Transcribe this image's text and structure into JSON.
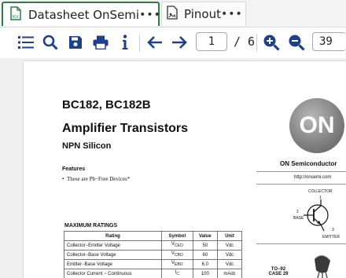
{
  "tabs": [
    {
      "label": "Datasheet OnSemi",
      "more": "•••"
    },
    {
      "label": "Pinout",
      "more": "•••"
    }
  ],
  "toolbar": {
    "page_current": "1",
    "page_total": "/ 6",
    "zoom": "39"
  },
  "document": {
    "part_number": "BC182, BC182B",
    "title": "Amplifier Transistors",
    "subtitle": "NPN Silicon",
    "features_heading": "Features",
    "features": [
      "These are Pb−Free Devices*"
    ],
    "max_ratings_heading": "MAXIMUM RATINGS",
    "ratings_headers": [
      "Rating",
      "Symbol",
      "Value",
      "Unit"
    ],
    "ratings_rows": [
      [
        "Collector−Emitter Voltage",
        "V",
        "CEO",
        "50",
        "Vdc"
      ],
      [
        "Collector−Base Voltage",
        "V",
        "CBO",
        "60",
        "Vdc"
      ],
      [
        "Emitter−Base Voltage",
        "V",
        "EBO",
        "6.0",
        "Vdc"
      ],
      [
        "Collector Current − Continuous",
        "I",
        "C",
        "100",
        "mAdc"
      ]
    ],
    "logo_text": "ON",
    "brand": "ON Semiconductor",
    "url": "http://onsemi.com",
    "pin_labels": {
      "collector": "COLLECTOR",
      "collector_pin": "1",
      "base": "BASE",
      "base_pin": "2",
      "emitter": "EMITTER",
      "emitter_pin": "3"
    },
    "package": "TO−92",
    "case": "CASE 29"
  },
  "colors": {
    "active_tab_border": "#2d7d46",
    "icon": "#1c3f8f"
  }
}
